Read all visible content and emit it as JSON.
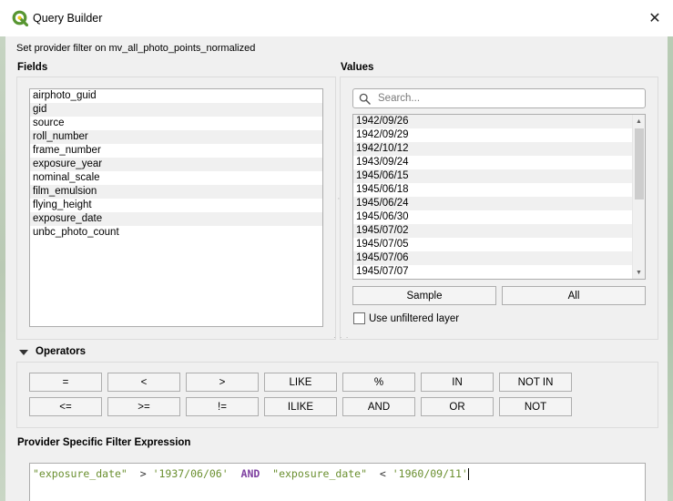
{
  "window": {
    "title": "Query Builder",
    "close_glyph": "✕"
  },
  "subtitle": "Set provider filter on mv_all_photo_points_normalized",
  "fields": {
    "label": "Fields",
    "items": [
      "airphoto_guid",
      "gid",
      "source",
      "roll_number",
      "frame_number",
      "exposure_year",
      "nominal_scale",
      "film_emulsion",
      "flying_height",
      "exposure_date",
      "unbc_photo_count"
    ]
  },
  "values": {
    "label": "Values",
    "search_placeholder": "Search...",
    "items": [
      "1942/09/26",
      "1942/09/29",
      "1942/10/12",
      "1943/09/24",
      "1945/06/15",
      "1945/06/18",
      "1945/06/24",
      "1945/06/30",
      "1945/07/02",
      "1945/07/05",
      "1945/07/06",
      "1945/07/07"
    ],
    "sample_label": "Sample",
    "all_label": "All",
    "unfiltered_label": "Use unfiltered layer",
    "unfiltered_checked": false
  },
  "operators": {
    "label": "Operators",
    "row1": [
      "=",
      "<",
      ">",
      "LIKE",
      "%",
      "IN",
      "NOT IN"
    ],
    "row2": [
      "<=",
      ">=",
      "!=",
      "ILIKE",
      "AND",
      "OR",
      "NOT"
    ]
  },
  "expression": {
    "label": "Provider Specific Filter Expression",
    "tokens": [
      {
        "text": "\"exposure_date\"",
        "kind": "str"
      },
      {
        "text": "  > ",
        "kind": "op"
      },
      {
        "text": "'1937/06/06'",
        "kind": "lit"
      },
      {
        "text": "  ",
        "kind": "op"
      },
      {
        "text": "AND",
        "kind": "kw"
      },
      {
        "text": "  ",
        "kind": "op"
      },
      {
        "text": "\"exposure_date\"",
        "kind": "str"
      },
      {
        "text": "  < ",
        "kind": "op"
      },
      {
        "text": "'1960/09/11'",
        "kind": "lit"
      }
    ]
  },
  "colors": {
    "qgis_green": "#589632",
    "qgis_yellow": "#f0c71a",
    "keyword": "#7d3fa0",
    "string": "#6a8f2f"
  },
  "icons": {
    "app": "qgis-logo-icon",
    "close": "close-icon",
    "search": "search-icon",
    "collapse": "triangle-down-icon"
  }
}
